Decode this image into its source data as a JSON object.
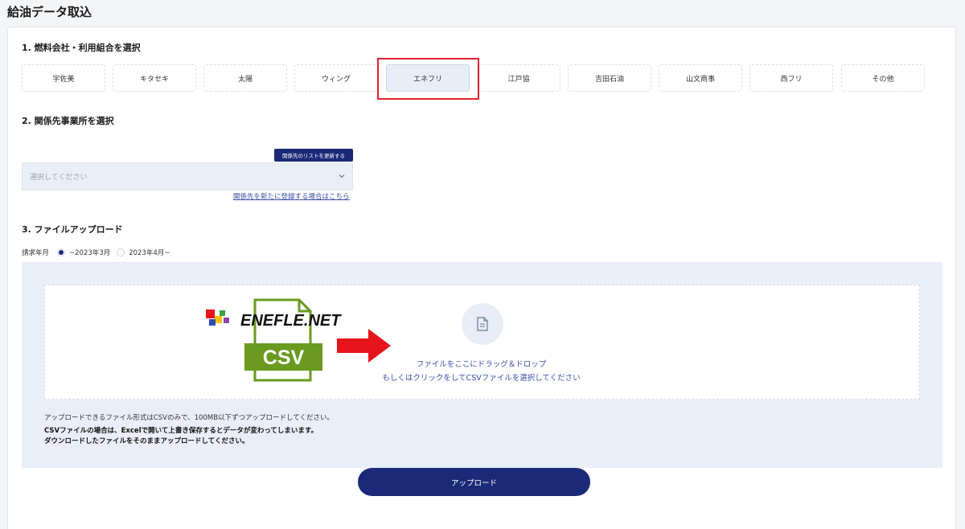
{
  "page": {
    "title": "給油データ取込"
  },
  "section1": {
    "title": "1. 燃料会社・利用組合を選択",
    "companies": [
      "宇佐美",
      "キタセキ",
      "太陽",
      "ウィング",
      "エネフリ",
      "江戸協",
      "吉田石油",
      "山文商事",
      "西フリ",
      "その他"
    ],
    "selected": "エネフリ"
  },
  "section2": {
    "title": "2. 関係先事業所を選択",
    "refresh_label": "関係先のリストを更新する",
    "select_placeholder": "選択してください",
    "register_link": "関係先を新たに登録する場合はこちら"
  },
  "section3": {
    "title": "3. ファイルアップロード",
    "billing_label": "請求年月",
    "radio_options": [
      "~2023年3月",
      "2023年4月~"
    ],
    "selected_radio": "~2023年3月",
    "logo_text": "ENEFLE.NET",
    "csv_label": "CSV",
    "drop_text_line1": "ファイルをここにドラッグ＆ドロップ",
    "drop_text_line2": "もしくはクリックをしてCSVファイルを選択してください",
    "note1": "アップロードできるファイル形式はCSVのみで、100MB以下ずつアップロードしてください。",
    "note2": "CSVファイルの場合は、Excelで開いて上書き保存するとデータが変わってしまいます。",
    "note3": "ダウンロードしたファイルをそのままアップロードしてください。"
  },
  "upload_button_label": "アップロード",
  "colors": {
    "primary": "#1b2a78",
    "highlight": "#e0212b",
    "csv_green": "#6a9a1f",
    "arrow_red": "#e8141c"
  }
}
